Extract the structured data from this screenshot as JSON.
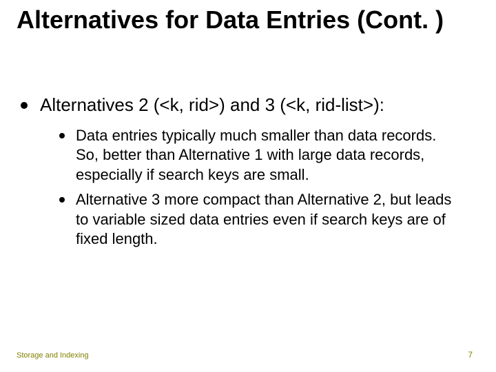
{
  "title": "Alternatives for Data Entries (Cont. )",
  "bullets": {
    "main": "Alternatives 2 (<k, rid>) and 3 (<k, rid-list>):",
    "subs": [
      "Data entries typically much smaller than data records.  So, better than Alternative 1 with large data records, especially if search keys are small.",
      "Alternative 3 more compact than Alternative 2, but leads to variable sized data entries even if search keys are of fixed length."
    ]
  },
  "footer": {
    "left": "Storage and Indexing",
    "page": "7"
  }
}
